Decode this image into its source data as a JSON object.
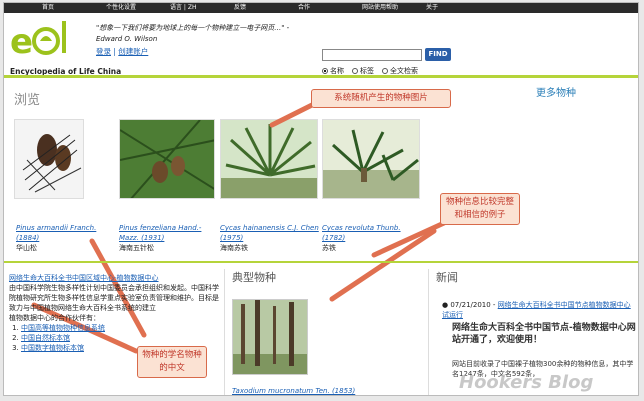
{
  "nav": {
    "items": [
      "首页",
      "个性化设置",
      "语言 | ZH",
      "反馈",
      "合作",
      "网站使用帮助",
      "关于"
    ]
  },
  "header": {
    "logo_text": "Encyclopedia of Life China",
    "quote": "\"想象一下我们将要为地球上的每一个物种建立一电子网页…\" - Edward O. Wilson",
    "login": "登录",
    "register": "创建账户",
    "search_placeholder": "",
    "find_label": "FIND",
    "radio_name": "名称",
    "radio_tag": "标签",
    "radio_fulltext": "全文检索"
  },
  "browse": {
    "title": "浏览",
    "more": "更多物种"
  },
  "photos": [
    {
      "latin": "Pinus armandii Franch. (1884)",
      "cn": "华山松"
    },
    {
      "latin": "Pinus fenzeliana Hand.-Mazz. (1931)",
      "cn": "海南五针松"
    },
    {
      "latin": "Cycas hainanensis C.J. Chen (1975)",
      "cn": "海南苏铁"
    },
    {
      "latin": "Cycas revoluta Thunb. (1782)",
      "cn": "苏铁"
    }
  ],
  "callouts": {
    "random": "系统随机产生的物种图片",
    "example": "物种信息比较完整和相信的例子",
    "names": "物种的学名物种的中文"
  },
  "left": {
    "head": "网络生命大百科全书中国区域中心-植物数据中心",
    "body": "由中国科学院生物多样性计划中国委员会承担组织和发起。中国科学院植物研究所生物多样性信息学重点实验室负责管理和维护。目标是致力与中国植物网络生命大百科全书系统的建立",
    "partners_label": "植物数据中心的合作伙伴有：",
    "partners": [
      "中国高等植物物种信息系统",
      "中国自然标本馆",
      "中国数字植物标本馆"
    ]
  },
  "featured": {
    "title": "典型物种",
    "caption": "Taxodium mucronatum Ten. (1853)"
  },
  "news": {
    "title": "新闻",
    "date": "07/21/2010",
    "link": "网络生命大百科全书中国节点植物数据中心试运行",
    "headline": "网络生命大百科全书中国节点-植物数据中心网站开通了，欢迎使用！",
    "body": "网站目前收录了中国裸子植物300余种的物种信息，其中学名1247条，中文名592条，"
  },
  "watermark": "Hookers Blog"
}
